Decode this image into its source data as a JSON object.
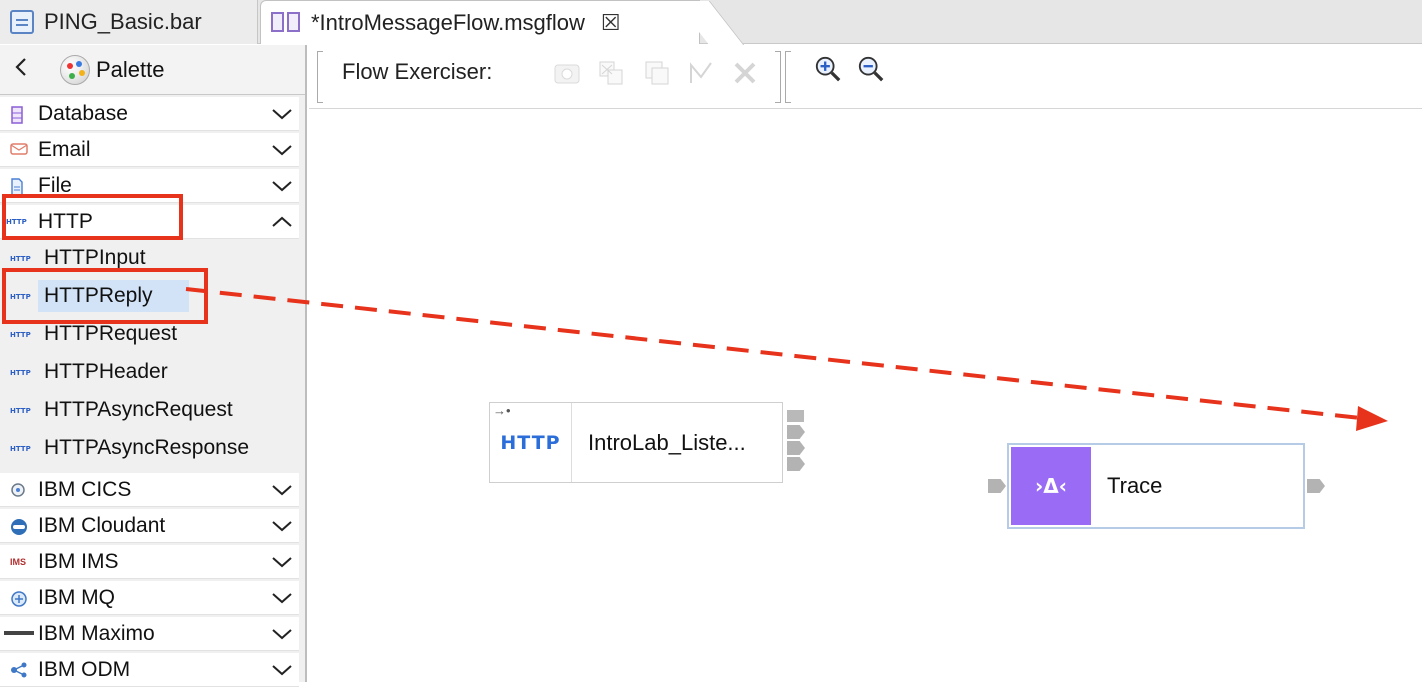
{
  "tabs": [
    {
      "label": "PING_Basic.bar",
      "icon": "bar-file-icon"
    },
    {
      "label": "*IntroMessageFlow.msgflow",
      "icon": "msgflow-file-icon",
      "close": "☒"
    }
  ],
  "palette": {
    "title": "Palette",
    "drawers": [
      {
        "label": "Database",
        "icon": "database-icon"
      },
      {
        "label": "Email",
        "icon": "email-icon"
      },
      {
        "label": "File",
        "icon": "file-icon"
      },
      {
        "label": "HTTP",
        "icon": "http-icon",
        "expanded": true
      }
    ],
    "http_entries": [
      "HTTPInput",
      "HTTPReply",
      "HTTPRequest",
      "HTTPHeader",
      "HTTPAsyncRequest",
      "HTTPAsyncResponse"
    ],
    "selected_entry": "HTTPReply",
    "more_drawers": [
      {
        "label": "IBM CICS",
        "icon": "cics-icon"
      },
      {
        "label": "IBM Cloudant",
        "icon": "cloudant-icon"
      },
      {
        "label": "IBM IMS",
        "icon": "ims-icon"
      },
      {
        "label": "IBM MQ",
        "icon": "mq-icon"
      },
      {
        "label": "IBM Maximo",
        "icon": "maximo-icon"
      },
      {
        "label": "IBM ODM",
        "icon": "odm-icon"
      }
    ],
    "mini_icon_text": "HTTP",
    "ims_icon_text": "IMS"
  },
  "toolbar": {
    "flow_exerciser_label": "Flow Exerciser:"
  },
  "canvas": {
    "nodes": [
      {
        "label": "IntroLab_Liste...",
        "icon_text": "HTTP",
        "type": "HTTPInput"
      },
      {
        "label": "Trace",
        "icon_text": "›Δ‹",
        "type": "Trace"
      }
    ],
    "annotation_color": "#e8331c",
    "trace_color": "#9a6cf6"
  }
}
